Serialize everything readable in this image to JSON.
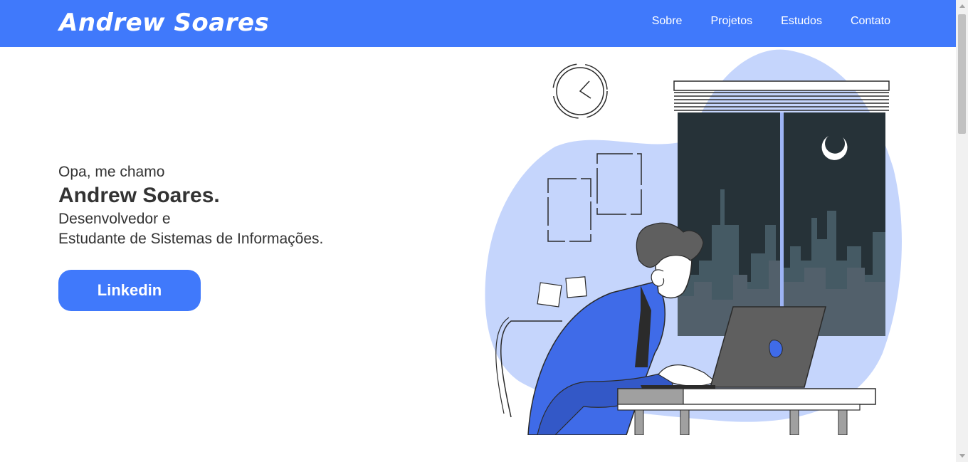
{
  "header": {
    "logo": "Andrew Soares",
    "nav": [
      "Sobre",
      "Projetos",
      "Estudos",
      "Contato"
    ]
  },
  "hero": {
    "greeting": "Opa, me chamo",
    "name": "Andrew Soares.",
    "role_line1": "Desenvolvedor e",
    "role_line2": "Estudante de Sistemas de Informações.",
    "button": "Linkedin"
  },
  "colors": {
    "brand": "#4079fb",
    "text": "#333333",
    "blob": "#c5d5fc"
  }
}
